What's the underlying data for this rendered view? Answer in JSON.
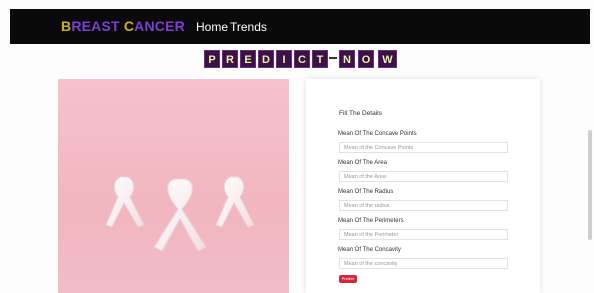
{
  "navbar": {
    "brand_first": "B",
    "brand_rest": "REAST ",
    "brand_c": "C",
    "brand_rest2": "ANCER",
    "links": [
      {
        "label": "Home"
      },
      {
        "label": "Trends"
      }
    ]
  },
  "hero": {
    "tiles_left": [
      "P",
      "R",
      "E",
      "D",
      "I",
      "C",
      "T"
    ],
    "separator": "-",
    "tiles_right": [
      "N",
      "O",
      "W"
    ]
  },
  "form": {
    "title": "Fill The Details",
    "fields": [
      {
        "label": "Mean Of The Concave Points",
        "placeholder": "Mean of the Concave Points"
      },
      {
        "label": "Mean Of The Area",
        "placeholder": "Mean of the Area"
      },
      {
        "label": "Mean Of The Radius",
        "placeholder": "Mean of the radius"
      },
      {
        "label": "Mean Of The Perimeters",
        "placeholder": "Mean of the Perimeter"
      },
      {
        "label": "Mean Of The Concavity",
        "placeholder": "Mean of the concavity"
      }
    ],
    "submit_label": "Predict"
  },
  "colors": {
    "navbar_bg": "#0a0a0a",
    "brand_accent": "#c9b21c",
    "brand_primary": "#7b3fd6",
    "tile_bg": "#3a1248",
    "tile_text": "#eef0a2",
    "photo_bg": "#f4bdc8",
    "button": "#d5293b"
  },
  "icons": {
    "photo": "pink-ribbons-image"
  }
}
